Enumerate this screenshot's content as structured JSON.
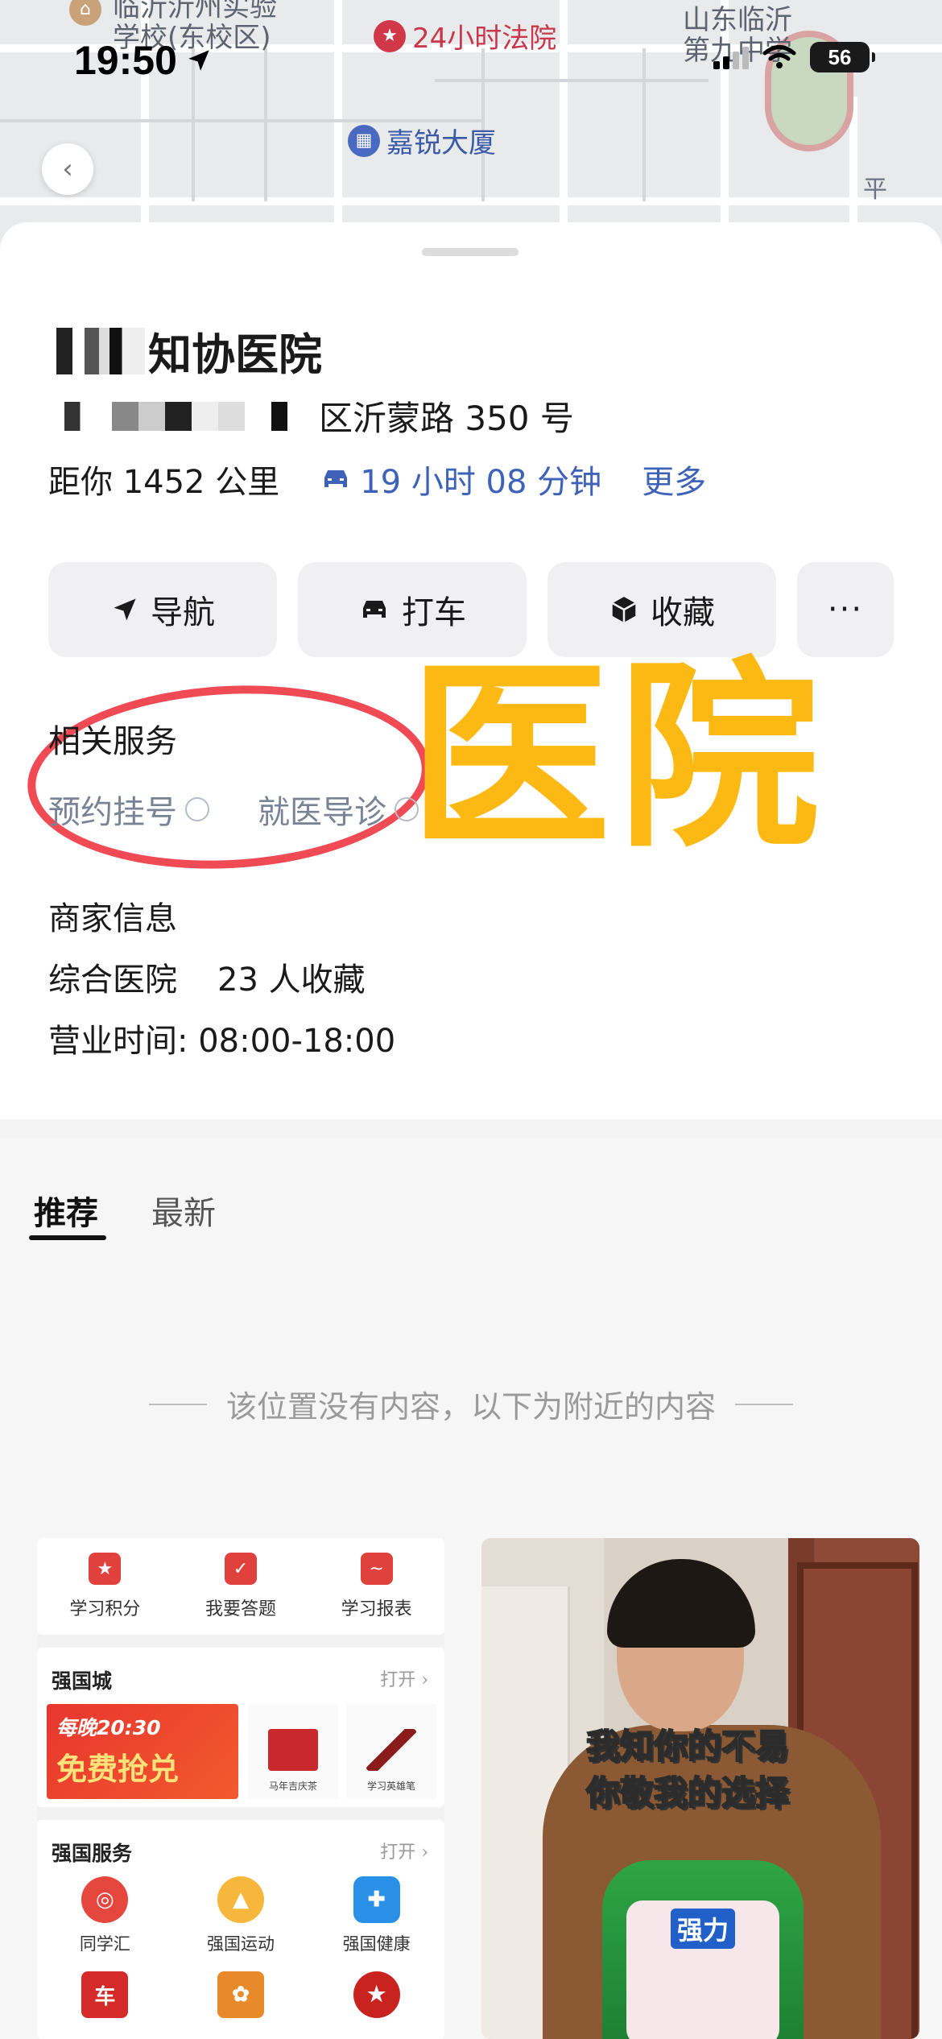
{
  "status_bar": {
    "time": "19:50",
    "battery": "56"
  },
  "map": {
    "poi_school_line1": "临沂沂州实验",
    "poi_school_line2": "学校(东校区)",
    "poi_court": "24小时法院",
    "poi_building": "嘉锐大厦",
    "poi_linyi_line1": "山东临沂",
    "poi_linyi_line2": "第九中学",
    "poi_road": "平"
  },
  "place": {
    "title": "知协医院",
    "address": "区沂蒙路 350 号",
    "distance": "距你 1452 公里",
    "drive_time": "19 小时 08 分钟",
    "more": "更多"
  },
  "actions": {
    "navigate": "导航",
    "taxi": "打车",
    "favorite": "收藏",
    "more": "···"
  },
  "services": {
    "title": "相关服务",
    "items": [
      "预约挂号",
      "就医导诊"
    ]
  },
  "overlay_text": "医院",
  "merchant": {
    "title": "商家信息",
    "category": "综合医院",
    "favorites": "23 人收藏",
    "hours": "营业时间: 08:00-18:00"
  },
  "tabs": [
    "推荐",
    "最新"
  ],
  "notice": "该位置没有内容，以下为附近的内容",
  "feed_left": {
    "top_items": [
      "学习积分",
      "我要答题",
      "学习报表"
    ],
    "city_title": "强国城",
    "city_open": "打开 ›",
    "banner_line1": "每晚20:30",
    "banner_line2": "免费抢兑",
    "product1": "马年吉庆茶",
    "product2": "学习英雄笔",
    "service_title": "强国服务",
    "service_open": "打开 ›",
    "service_items": [
      "同学汇",
      "强国运动",
      "强国健康"
    ],
    "service_row2_icon": "车"
  },
  "feed_right": {
    "caption_line1": "我知你的不易",
    "caption_line2": "你敬我的选择",
    "bottle_brand": "强力"
  },
  "colors": {
    "accent_blue": "#3d62b8",
    "overlay_yellow": "#fdb913",
    "annotation_red": "#f04a55"
  }
}
